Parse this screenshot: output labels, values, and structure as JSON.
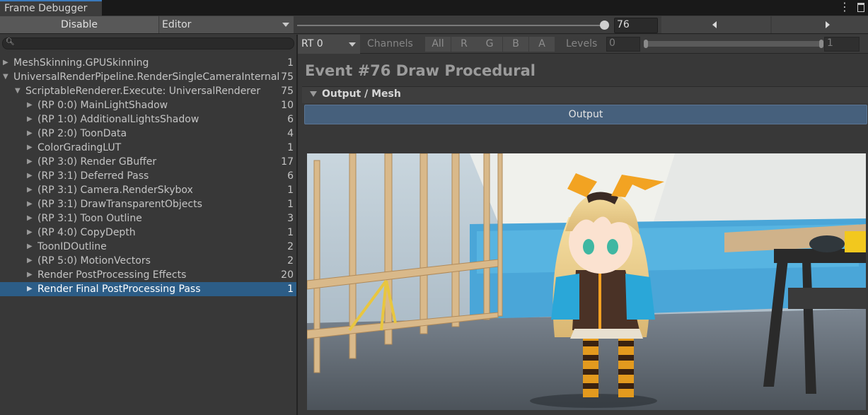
{
  "window": {
    "tab_title": "Frame Debugger",
    "menu_icon": "kebab-menu-icon",
    "maximize_icon": "maximize-icon"
  },
  "toolbar": {
    "disable_label": "Disable",
    "target_dropdown": "Editor",
    "event_slider_value": 76,
    "event_field_value": "76",
    "prev_icon": "triangle-left-icon",
    "next_icon": "triangle-right-icon"
  },
  "search": {
    "value": "",
    "icon": "search-icon"
  },
  "tree": [
    {
      "label": "MeshSkinning.GPUSkinning",
      "count": "1",
      "depth": 0,
      "expanded": false,
      "selected": false
    },
    {
      "label": "UniversalRenderPipeline.RenderSingleCameraInternal",
      "count": "75",
      "depth": 0,
      "expanded": true,
      "selected": false
    },
    {
      "label": "ScriptableRenderer.Execute: UniversalRenderer",
      "count": "75",
      "depth": 1,
      "expanded": true,
      "selected": false
    },
    {
      "label": "(RP 0:0) MainLightShadow",
      "count": "10",
      "depth": 2,
      "expanded": false,
      "selected": false
    },
    {
      "label": "(RP 1:0) AdditionalLightsShadow",
      "count": "6",
      "depth": 2,
      "expanded": false,
      "selected": false
    },
    {
      "label": "(RP 2:0) ToonData",
      "count": "4",
      "depth": 2,
      "expanded": false,
      "selected": false
    },
    {
      "label": "ColorGradingLUT",
      "count": "1",
      "depth": 2,
      "expanded": false,
      "selected": false
    },
    {
      "label": "(RP 3:0) Render GBuffer",
      "count": "17",
      "depth": 2,
      "expanded": false,
      "selected": false
    },
    {
      "label": "(RP 3:1) Deferred Pass",
      "count": "6",
      "depth": 2,
      "expanded": false,
      "selected": false
    },
    {
      "label": "(RP 3:1) Camera.RenderSkybox",
      "count": "1",
      "depth": 2,
      "expanded": false,
      "selected": false
    },
    {
      "label": "(RP 3:1) DrawTransparentObjects",
      "count": "1",
      "depth": 2,
      "expanded": false,
      "selected": false
    },
    {
      "label": "(RP 3:1) Toon Outline",
      "count": "3",
      "depth": 2,
      "expanded": false,
      "selected": false
    },
    {
      "label": "(RP 4:0) CopyDepth",
      "count": "1",
      "depth": 2,
      "expanded": false,
      "selected": false
    },
    {
      "label": "ToonIDOutline",
      "count": "2",
      "depth": 2,
      "expanded": false,
      "selected": false
    },
    {
      "label": "(RP 5:0) MotionVectors",
      "count": "2",
      "depth": 2,
      "expanded": false,
      "selected": false
    },
    {
      "label": "Render PostProcessing Effects",
      "count": "20",
      "depth": 2,
      "expanded": false,
      "selected": false
    },
    {
      "label": "Render Final PostProcessing Pass",
      "count": "1",
      "depth": 2,
      "expanded": false,
      "selected": true
    }
  ],
  "rt_bar": {
    "rt_dropdown": "RT 0",
    "channels_label": "Channels",
    "channels": [
      "All",
      "R",
      "G",
      "B",
      "A"
    ],
    "levels_label": "Levels",
    "levels_min": "0",
    "levels_max": "1"
  },
  "details": {
    "event_title": "Event #76 Draw Procedural",
    "section_title": "Output / Mesh",
    "output_button": "Output"
  },
  "colors": {
    "selection": "#2c5d87",
    "output_button": "#46607c",
    "tab_accent": "#3a79bb"
  }
}
